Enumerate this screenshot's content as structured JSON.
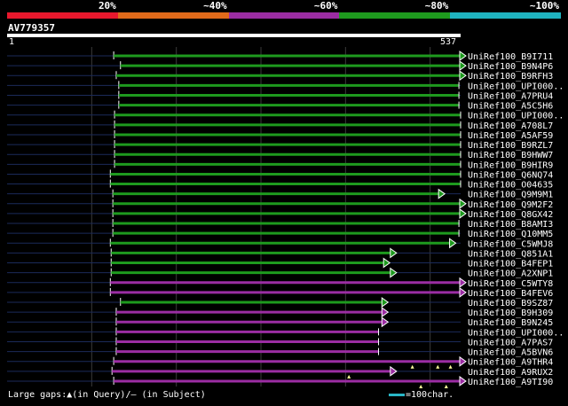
{
  "identity_legend": [
    {
      "label": "20%",
      "color": "#e8182d"
    },
    {
      "label": "~40%",
      "color": "#e06a1a"
    },
    {
      "label": "~60%",
      "color": "#9b2da3"
    },
    {
      "label": "~80%",
      "color": "#1e9a1e"
    },
    {
      "label": "~100%",
      "color": "#1fb3c0"
    }
  ],
  "query": {
    "id": "AV779357",
    "start": "1",
    "end": "537",
    "length": 537
  },
  "gap_marker_color": "#ffff99",
  "hits": [
    {
      "name": "UniRef100_B9I711",
      "color": "#1e9a1e",
      "start": 127,
      "end": 537,
      "arrow": true,
      "gaps": []
    },
    {
      "name": "UniRef100_B9N4P6",
      "color": "#1e9a1e",
      "start": 135,
      "end": 537,
      "arrow": true,
      "gaps": []
    },
    {
      "name": "UniRef100_B9RFH3",
      "color": "#1e9a1e",
      "start": 130,
      "end": 537,
      "arrow": true,
      "gaps": []
    },
    {
      "name": "UniRef100_UPI000..",
      "color": "#1e9a1e",
      "start": 133,
      "end": 535,
      "arrow": false,
      "gaps": []
    },
    {
      "name": "UniRef100_A7PRU4",
      "color": "#1e9a1e",
      "start": 133,
      "end": 535,
      "arrow": false,
      "gaps": []
    },
    {
      "name": "UniRef100_A5C5H6",
      "color": "#1e9a1e",
      "start": 133,
      "end": 535,
      "arrow": false,
      "gaps": []
    },
    {
      "name": "UniRef100_UPI000..",
      "color": "#1e9a1e",
      "start": 128,
      "end": 537,
      "arrow": false,
      "gaps": []
    },
    {
      "name": "UniRef100_A708L7",
      "color": "#1e9a1e",
      "start": 128,
      "end": 537,
      "arrow": false,
      "gaps": []
    },
    {
      "name": "UniRef100_A5AF59",
      "color": "#1e9a1e",
      "start": 128,
      "end": 537,
      "arrow": false,
      "gaps": []
    },
    {
      "name": "UniRef100_B9RZL7",
      "color": "#1e9a1e",
      "start": 128,
      "end": 537,
      "arrow": false,
      "gaps": []
    },
    {
      "name": "UniRef100_B9HWW7",
      "color": "#1e9a1e",
      "start": 128,
      "end": 537,
      "arrow": false,
      "gaps": []
    },
    {
      "name": "UniRef100_B9HIR9",
      "color": "#1e9a1e",
      "start": 128,
      "end": 537,
      "arrow": false,
      "gaps": []
    },
    {
      "name": "UniRef100_Q6NQ74",
      "color": "#1e9a1e",
      "start": 123,
      "end": 537,
      "arrow": false,
      "gaps": []
    },
    {
      "name": "UniRef100_O04635",
      "color": "#1e9a1e",
      "start": 123,
      "end": 537,
      "arrow": false,
      "gaps": []
    },
    {
      "name": "UniRef100_Q9M9M1",
      "color": "#1e9a1e",
      "start": 126,
      "end": 512,
      "arrow": true,
      "gaps": []
    },
    {
      "name": "UniRef100_Q9M2F2",
      "color": "#1e9a1e",
      "start": 126,
      "end": 537,
      "arrow": true,
      "gaps": []
    },
    {
      "name": "UniRef100_Q8GX42",
      "color": "#1e9a1e",
      "start": 126,
      "end": 537,
      "arrow": true,
      "gaps": []
    },
    {
      "name": "UniRef100_B8AMI3",
      "color": "#1e9a1e",
      "start": 126,
      "end": 535,
      "arrow": false,
      "gaps": []
    },
    {
      "name": "UniRef100_Q10MM5",
      "color": "#1e9a1e",
      "start": 126,
      "end": 535,
      "arrow": false,
      "gaps": []
    },
    {
      "name": "UniRef100_C5WMJ8",
      "color": "#1e9a1e",
      "start": 123,
      "end": 525,
      "arrow": true,
      "gaps": []
    },
    {
      "name": "UniRef100_Q851A1",
      "color": "#1e9a1e",
      "start": 124,
      "end": 455,
      "arrow": true,
      "gaps": []
    },
    {
      "name": "UniRef100_B4FEP1",
      "color": "#1e9a1e",
      "start": 124,
      "end": 447,
      "arrow": true,
      "gaps": []
    },
    {
      "name": "UniRef100_A2XNP1",
      "color": "#1e9a1e",
      "start": 124,
      "end": 455,
      "arrow": true,
      "gaps": []
    },
    {
      "name": "UniRef100_C5WTY8",
      "color": "#9b2da3",
      "start": 123,
      "end": 537,
      "arrow": true,
      "gaps": []
    },
    {
      "name": "UniRef100_B4FEV6",
      "color": "#9b2da3",
      "start": 123,
      "end": 537,
      "arrow": true,
      "gaps": []
    },
    {
      "name": "UniRef100_B9SZ87",
      "color": "#1e9a1e",
      "start": 135,
      "end": 445,
      "arrow": true,
      "gaps": []
    },
    {
      "name": "UniRef100_B9H309",
      "color": "#9b2da3",
      "start": 130,
      "end": 445,
      "arrow": true,
      "gaps": []
    },
    {
      "name": "UniRef100_B9N245",
      "color": "#9b2da3",
      "start": 130,
      "end": 445,
      "arrow": true,
      "gaps": []
    },
    {
      "name": "UniRef100_UPI000..",
      "color": "#9b2da3",
      "start": 130,
      "end": 440,
      "arrow": false,
      "gaps": []
    },
    {
      "name": "UniRef100_A7PAS7",
      "color": "#9b2da3",
      "start": 130,
      "end": 440,
      "arrow": false,
      "gaps": []
    },
    {
      "name": "UniRef100_A5BVN6",
      "color": "#9b2da3",
      "start": 130,
      "end": 440,
      "arrow": false,
      "gaps": []
    },
    {
      "name": "UniRef100_A9THR4",
      "color": "#9b2da3",
      "start": 127,
      "end": 537,
      "arrow": true,
      "gaps": [
        480,
        510,
        525
      ]
    },
    {
      "name": "UniRef100_A9RUX2",
      "color": "#9b2da3",
      "start": 125,
      "end": 455,
      "arrow": true,
      "gaps": [
        405
      ]
    },
    {
      "name": "UniRef100_A9TI90",
      "color": "#9b2da3",
      "start": 127,
      "end": 537,
      "arrow": true,
      "gaps": [
        490,
        520
      ]
    }
  ],
  "footer": {
    "text": "Large gaps:▲(in Query)/– (in Subject)"
  },
  "scale": {
    "label": "=100char.",
    "color": "#29b6c6"
  }
}
